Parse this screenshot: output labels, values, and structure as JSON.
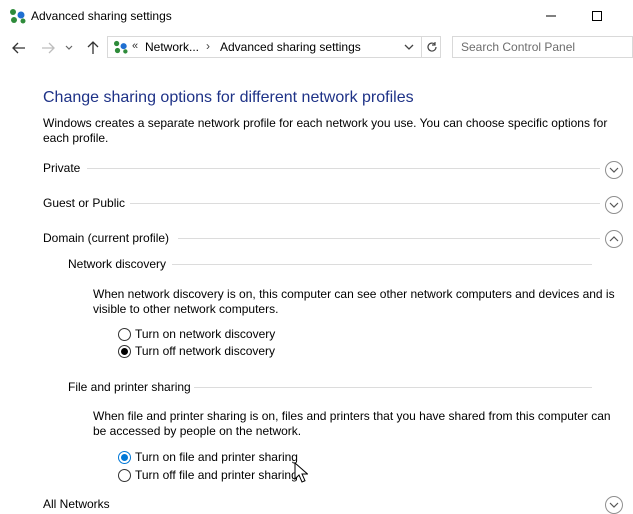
{
  "window": {
    "title": "Advanced sharing settings",
    "icon": "network-sharing-icon"
  },
  "address": {
    "chevron": "«",
    "crumb1": "Network...",
    "separator": "›",
    "crumb2": "Advanced sharing settings",
    "search_placeholder": "Search Control Panel"
  },
  "main": {
    "heading": "Change sharing options for different network profiles",
    "description": "Windows creates a separate network profile for each network you use. You can choose specific options for each profile."
  },
  "profiles": {
    "private": {
      "label": "Private",
      "expanded": false
    },
    "guest": {
      "label": "Guest or Public",
      "expanded": false
    },
    "domain": {
      "label": "Domain (current profile)",
      "expanded": true
    },
    "all": {
      "label": "All Networks",
      "expanded": false
    }
  },
  "network_discovery": {
    "title": "Network discovery",
    "description": "When network discovery is on, this computer can see other network computers and devices and is visible to other network computers.",
    "options": [
      {
        "label": "Turn on network discovery",
        "selected": false
      },
      {
        "label": "Turn off network discovery",
        "selected": true
      }
    ]
  },
  "file_sharing": {
    "title": "File and printer sharing",
    "description": "When file and printer sharing is on, files and printers that you have shared from this computer can be accessed by people on the network.",
    "options": [
      {
        "label": "Turn on file and printer sharing",
        "selected": true
      },
      {
        "label": "Turn off file and printer sharing",
        "selected": false
      }
    ]
  },
  "colors": {
    "heading": "#1e3287",
    "accent": "#0078d7"
  }
}
